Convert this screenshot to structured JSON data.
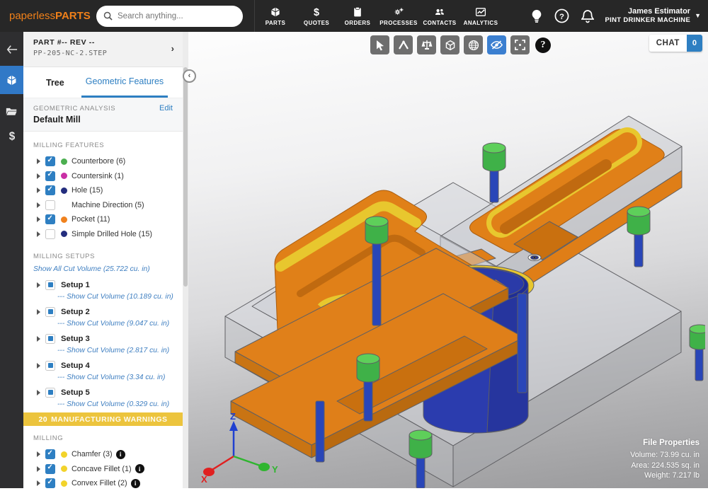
{
  "topbar": {
    "logo": {
      "text_regular": "paperless",
      "text_bold": "PARTS",
      "brand_color": "#f08019"
    },
    "search": {
      "placeholder": "Search anything..."
    },
    "nav": [
      {
        "label": "PARTS",
        "icon": "cube-icon"
      },
      {
        "label": "QUOTES",
        "icon": "dollar-icon"
      },
      {
        "label": "ORDERS",
        "icon": "clipboard-icon"
      },
      {
        "label": "PROCESSES",
        "icon": "gears-icon"
      },
      {
        "label": "CONTACTS",
        "icon": "people-icon"
      },
      {
        "label": "ANALYTICS",
        "icon": "chart-icon"
      }
    ],
    "right_icons": [
      "lightbulb-icon",
      "help-icon",
      "bell-icon"
    ],
    "user": {
      "name": "James Estimator",
      "company": "PINT DRINKER MACHINE"
    }
  },
  "sidebar": {
    "part_header": {
      "title": "PART #-- REV --",
      "filename": "PP-205-NC-2.STEP"
    },
    "tabs": [
      {
        "label": "Tree",
        "active": false
      },
      {
        "label": "Geometric Features",
        "active": true
      }
    ],
    "analysis": {
      "label": "GEOMETRIC ANALYSIS",
      "value": "Default Mill",
      "edit_label": "Edit"
    },
    "milling_features": {
      "title": "MILLING FEATURES",
      "items": [
        {
          "label": "Counterbore (6)",
          "checked": true,
          "dot_color": "#4caf50"
        },
        {
          "label": "Countersink (1)",
          "checked": true,
          "dot_color": "#c92fa5"
        },
        {
          "label": "Hole (15)",
          "checked": true,
          "dot_color": "#232d7e"
        },
        {
          "label": "Machine Direction (5)",
          "checked": false,
          "dot_color": ""
        },
        {
          "label": "Pocket (11)",
          "checked": true,
          "dot_color": "#f0821e"
        },
        {
          "label": "Simple Drilled Hole (15)",
          "checked": false,
          "dot_color": "#232d7e"
        }
      ]
    },
    "milling_setups": {
      "title": "MILLING SETUPS",
      "show_all_link": "Show All Cut Volume (25.722 cu. in)",
      "setups": [
        {
          "label": "Setup 1",
          "volume_link": "--- Show Cut Volume (10.189 cu. in)"
        },
        {
          "label": "Setup 2",
          "volume_link": "--- Show Cut Volume (9.047 cu. in)"
        },
        {
          "label": "Setup 3",
          "volume_link": "--- Show Cut Volume (2.817 cu. in)"
        },
        {
          "label": "Setup 4",
          "volume_link": "--- Show Cut Volume (3.34 cu. in)"
        },
        {
          "label": "Setup 5",
          "volume_link": "--- Show Cut Volume (0.329 cu. in)"
        }
      ]
    },
    "warnings_banner": {
      "count": "20",
      "label": "MANUFACTURING WARNINGS",
      "color": "#ecc43d"
    },
    "milling": {
      "title": "MILLING",
      "items": [
        {
          "label": "Chamfer (3)",
          "checked": true,
          "dot_color": "#f2d32b",
          "info": "i"
        },
        {
          "label": "Concave Fillet (1)",
          "checked": true,
          "dot_color": "#f2d32b",
          "info": "i"
        },
        {
          "label": "Convex Fillet (2)",
          "checked": true,
          "dot_color": "#f2d32b",
          "info": "i"
        }
      ]
    }
  },
  "viewer": {
    "toolbar_icons": [
      "cursor-icon",
      "measure-icon",
      "assembly-icon",
      "cube-view-icon",
      "globe-icon",
      "hide-features-icon",
      "fit-view-icon"
    ],
    "active_tool": "hide-features-icon",
    "help_label": "?",
    "chat": {
      "label": "CHAT",
      "badge": "0"
    },
    "axis": {
      "x": "X",
      "y": "Y",
      "z": "Z",
      "x_color": "#e02020",
      "y_color": "#2fb52f",
      "z_color": "#2040d0"
    },
    "file_properties": {
      "title": "File Properties",
      "volume": "Volume: 73.99 cu. in",
      "area": "Area: 224.535 sq. in",
      "weight": "Weight: 7.217 lb"
    },
    "model_colors": {
      "body": "#e08018",
      "rim": "#f0d22a",
      "holes": "#2b3cae",
      "pins": "#4fc452",
      "countersink": "#c73da5",
      "plate": "#c9cbd1"
    }
  }
}
